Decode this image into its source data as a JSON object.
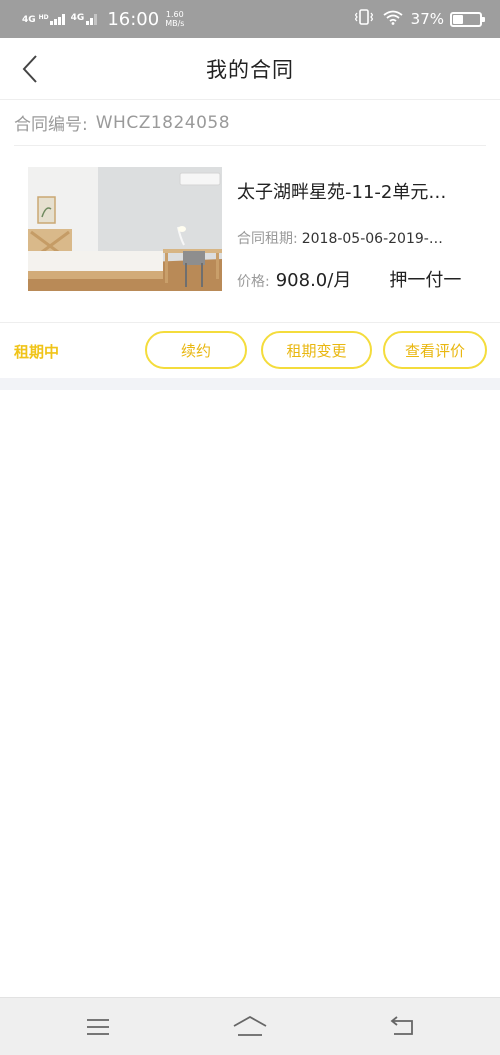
{
  "status_bar": {
    "network1": "4G",
    "network1_hd": "HD",
    "network2": "4G",
    "time": "16:00",
    "speed_value": "1.60",
    "speed_unit": "MB/s",
    "battery_percent": "37%",
    "battery_level": 0.37,
    "icons": [
      "signal-icon",
      "vibrate-icon",
      "wifi-icon",
      "battery-icon"
    ]
  },
  "header": {
    "title": "我的合同",
    "back_icon": "chevron-left-icon"
  },
  "contract": {
    "number_label": "合同编号:",
    "number_value": "WHCZ1824058"
  },
  "card": {
    "title": "太子湖畔星苑-11-2单元…",
    "period_label": "合同租期:",
    "period_value": "2018-05-06-2019-…",
    "price_label": "价格:",
    "price_value": "908.0/月",
    "payment_terms": "押一付一"
  },
  "actions": {
    "status": "租期中",
    "renew_label": "续约",
    "change_label": "租期变更",
    "review_label": "查看评价"
  },
  "bottom_nav": {
    "icons": [
      "menu-icon",
      "home-icon",
      "back-icon"
    ]
  },
  "colors": {
    "status_bar_bg": "#9e9e9e",
    "accent_yellow": "#f4dc3c",
    "accent_text": "#e9b710",
    "divider_band": "#f2f3f7",
    "nav_bg": "#efefef"
  }
}
